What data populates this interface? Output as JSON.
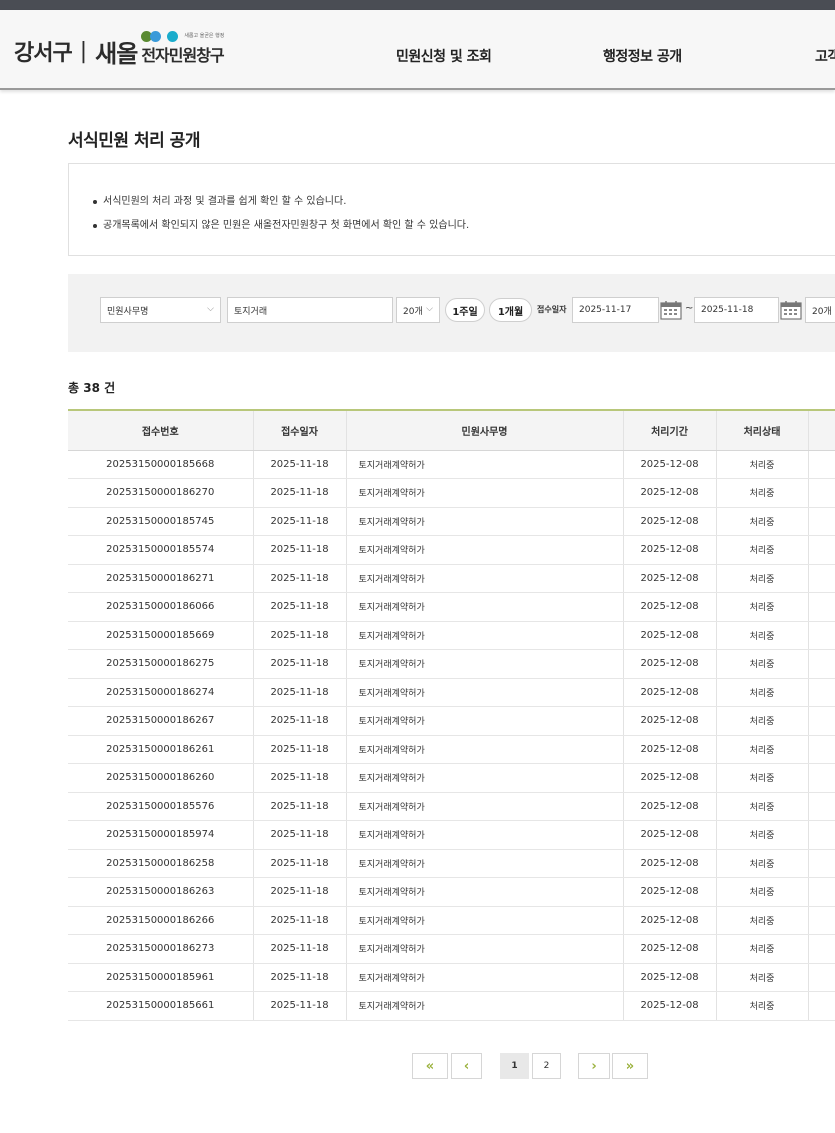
{
  "header": {
    "logo": {
      "district": "강서구",
      "separator": "|",
      "brand": "새올",
      "tagline": "새롭고 올곧은 행정",
      "service": "전자민원창구"
    },
    "nav": [
      "민원신청 및 조회",
      "행정정보 공개",
      "고객"
    ]
  },
  "page": {
    "title": "서식민원 처리 공개",
    "notices": [
      "서식민원의 처리 과정 및 결과를 쉽게 확인 할 수 있습니다.",
      "공개목록에서 확인되지 않은 민원은 새올전자민원창구 첫 화면에서 확인 할 수 있습니다."
    ]
  },
  "search": {
    "field_select": "민원사무명",
    "keyword": "토지거래",
    "count_select": "20개",
    "week_button": "1주일",
    "month_button": "1개월",
    "date_label": "접수일자",
    "date_from": "2025-11-17",
    "tilde": "~",
    "date_to": "2025-11-18",
    "page_size": "20개"
  },
  "total": "총 38 건",
  "table": {
    "columns": [
      "접수번호",
      "접수일자",
      "민원사무명",
      "처리기간",
      "처리상태",
      ""
    ],
    "rows": [
      [
        "20253150000185668",
        "2025-11-18",
        "토지거래계약허가",
        "2025-12-08",
        "처리중"
      ],
      [
        "20253150000186270",
        "2025-11-18",
        "토지거래계약허가",
        "2025-12-08",
        "처리중"
      ],
      [
        "20253150000185745",
        "2025-11-18",
        "토지거래계약허가",
        "2025-12-08",
        "처리중"
      ],
      [
        "20253150000185574",
        "2025-11-18",
        "토지거래계약허가",
        "2025-12-08",
        "처리중"
      ],
      [
        "20253150000186271",
        "2025-11-18",
        "토지거래계약허가",
        "2025-12-08",
        "처리중"
      ],
      [
        "20253150000186066",
        "2025-11-18",
        "토지거래계약허가",
        "2025-12-08",
        "처리중"
      ],
      [
        "20253150000185669",
        "2025-11-18",
        "토지거래계약허가",
        "2025-12-08",
        "처리중"
      ],
      [
        "20253150000186275",
        "2025-11-18",
        "토지거래계약허가",
        "2025-12-08",
        "처리중"
      ],
      [
        "20253150000186274",
        "2025-11-18",
        "토지거래계약허가",
        "2025-12-08",
        "처리중"
      ],
      [
        "20253150000186267",
        "2025-11-18",
        "토지거래계약허가",
        "2025-12-08",
        "처리중"
      ],
      [
        "20253150000186261",
        "2025-11-18",
        "토지거래계약허가",
        "2025-12-08",
        "처리중"
      ],
      [
        "20253150000186260",
        "2025-11-18",
        "토지거래계약허가",
        "2025-12-08",
        "처리중"
      ],
      [
        "20253150000185576",
        "2025-11-18",
        "토지거래계약허가",
        "2025-12-08",
        "처리중"
      ],
      [
        "20253150000185974",
        "2025-11-18",
        "토지거래계약허가",
        "2025-12-08",
        "처리중"
      ],
      [
        "20253150000186258",
        "2025-11-18",
        "토지거래계약허가",
        "2025-12-08",
        "처리중"
      ],
      [
        "20253150000186263",
        "2025-11-18",
        "토지거래계약허가",
        "2025-12-08",
        "처리중"
      ],
      [
        "20253150000186266",
        "2025-11-18",
        "토지거래계약허가",
        "2025-12-08",
        "처리중"
      ],
      [
        "20253150000186273",
        "2025-11-18",
        "토지거래계약허가",
        "2025-12-08",
        "처리중"
      ],
      [
        "20253150000185961",
        "2025-11-18",
        "토지거래계약허가",
        "2025-12-08",
        "처리중"
      ],
      [
        "20253150000185661",
        "2025-11-18",
        "토지거래계약허가",
        "2025-12-08",
        "처리중"
      ]
    ]
  },
  "pagination": {
    "first": "«",
    "prev": "‹",
    "pages": [
      "1",
      "2"
    ],
    "next": "›",
    "last": "»"
  },
  "colors": {
    "header_bg": "#f7f7f7",
    "top_strip": "#4a4d54",
    "table_accent": "#b8c77a",
    "pager_arrow": "#9bb23e",
    "logo_green": "#5a8a32",
    "logo_blue": "#3a9ad9",
    "logo_teal": "#1aaccc"
  },
  "icons": {
    "calendar": "calendar-icon",
    "select_arrow": "chevron-down-icon"
  }
}
